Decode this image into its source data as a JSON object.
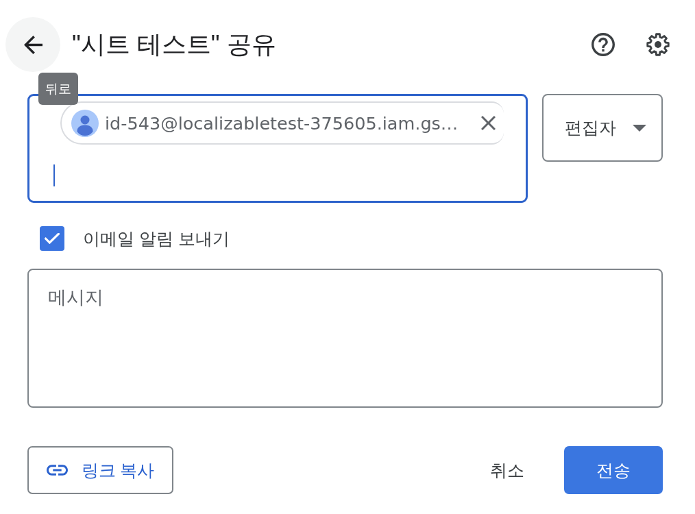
{
  "header": {
    "back_button": {
      "tooltip": "뒤로"
    },
    "title": "\"시트 테스트\" 공유"
  },
  "recipients": {
    "focused": true,
    "chips": [
      {
        "email": "id-543@localizabletest-375605.iam.gs…"
      }
    ]
  },
  "role_dropdown": {
    "value": "편집자"
  },
  "notify": {
    "label": "이메일 알림 보내기",
    "checked": true
  },
  "message": {
    "placeholder": "메시지"
  },
  "buttons": [
    {
      "kind": "link",
      "label": "링크 복사"
    },
    {
      "kind": "text",
      "label": "취소"
    },
    {
      "kind": "primary",
      "label": "전송"
    }
  ]
}
